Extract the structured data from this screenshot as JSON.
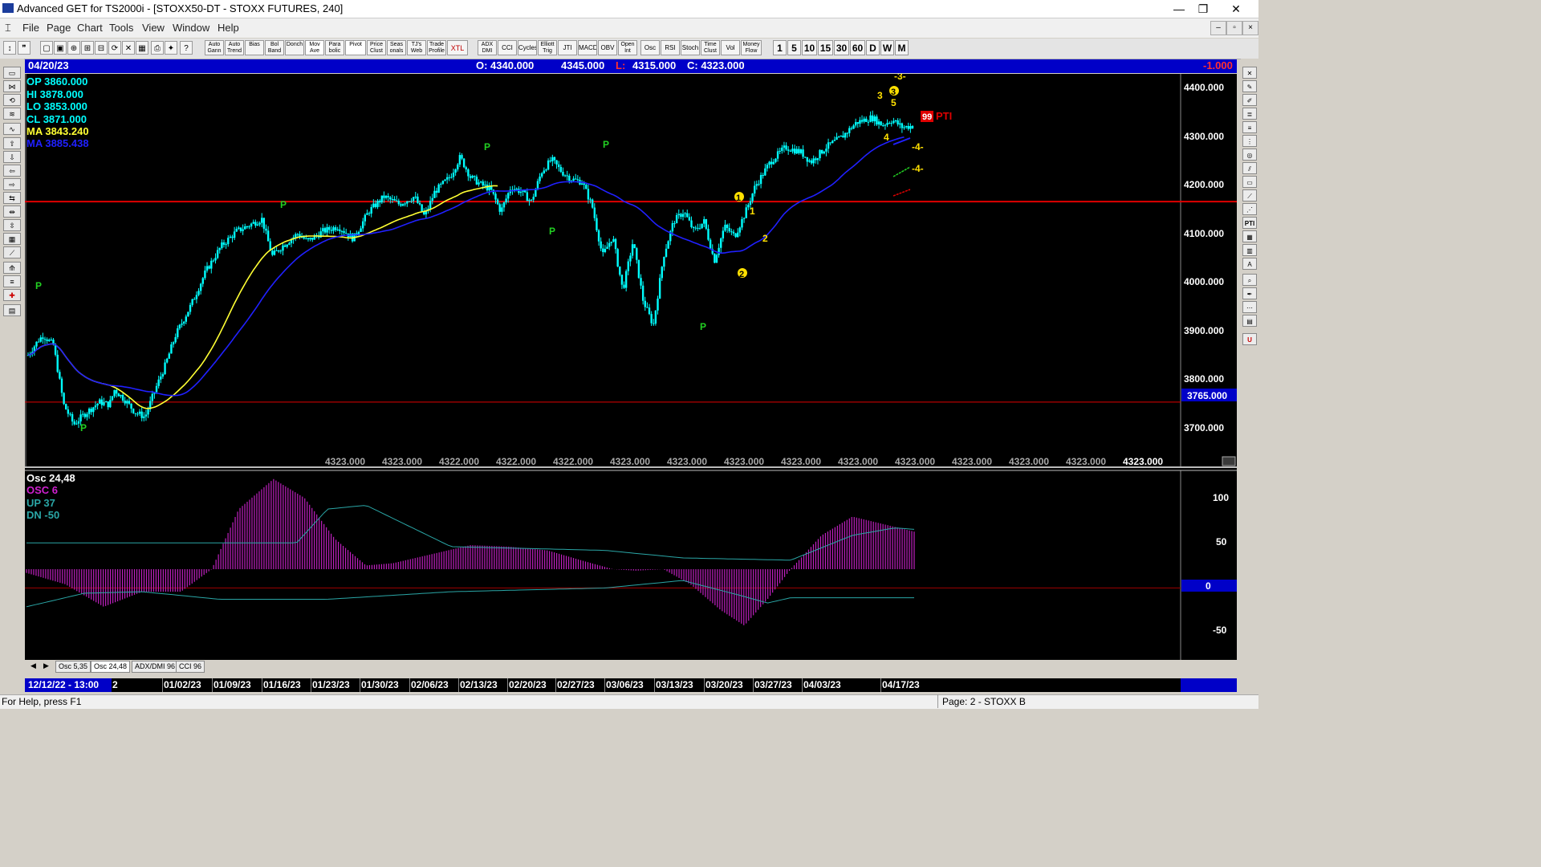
{
  "window": {
    "title": "Advanced GET for TS2000i - [STOXX50-DT - STOXX FUTURES, 240]",
    "buttons": [
      "—",
      "❐",
      "✕"
    ]
  },
  "menu": {
    "items": [
      "File",
      "Page",
      "Chart",
      "Tools",
      "View",
      "Window",
      "Help"
    ]
  },
  "toolbar": {
    "study_buttons": [
      "Auto Gann",
      "Auto Trend",
      "Bias",
      "Bol Band",
      "Donch",
      "Mov Ave",
      "Para bolic",
      "Pivot",
      "Price Clust",
      "Seas onals",
      "TJ's Web",
      "Trade Profile",
      "XTL",
      "ADX DMI",
      "CCI",
      "Cycles",
      "Elliott Trig",
      "JTI",
      "MACD",
      "OBV",
      "Open Int",
      "Osc",
      "RSI",
      "Stoch",
      "Time Clust",
      "Vol",
      "Money Flow"
    ],
    "timeframes": [
      "1",
      "5",
      "10",
      "15",
      "30",
      "60",
      "D",
      "W",
      "M"
    ]
  },
  "infobar": {
    "date": "04/20/23",
    "open": "O: 4340.000",
    "high": "4345.000",
    "low_label": "L:",
    "low": "4315.000",
    "close": "C: 4323.000",
    "change": "-1.000"
  },
  "legend": {
    "op": "OP  3860.000",
    "hi": "HI   3878.000",
    "lo": "LO   3853.000",
    "cl": "CL   3871.000",
    "ma": "MA  3843.240",
    "ma2": "MA  3885.438"
  },
  "chart_data": [
    {
      "type": "candlestick",
      "title": "STOXX50-DT - STOXX FUTURES, 240",
      "ylim": [
        3640,
        4420
      ],
      "y_ticks": [
        "4400.000",
        "4300.000",
        "4200.000",
        "4100.000",
        "4000.000",
        "3900.000",
        "3800.000",
        "3700.000"
      ],
      "price_path": [
        [
          0,
          3860
        ],
        [
          2,
          3890
        ],
        [
          3,
          3900
        ],
        [
          5,
          3880
        ],
        [
          7,
          3760
        ],
        [
          9,
          3720
        ],
        [
          11,
          3740
        ],
        [
          14,
          3765
        ],
        [
          16,
          3760
        ],
        [
          17,
          3790
        ],
        [
          19,
          3770
        ],
        [
          21,
          3745
        ],
        [
          23,
          3735
        ],
        [
          25,
          3790
        ],
        [
          27,
          3840
        ],
        [
          29,
          3900
        ],
        [
          32,
          3960
        ],
        [
          35,
          4030
        ],
        [
          38,
          4080
        ],
        [
          41,
          4110
        ],
        [
          44,
          4125
        ],
        [
          46,
          4135
        ],
        [
          48,
          4060
        ],
        [
          50,
          4080
        ],
        [
          53,
          4105
        ],
        [
          55,
          4090
        ],
        [
          58,
          4110
        ],
        [
          61,
          4120
        ],
        [
          64,
          4095
        ],
        [
          67,
          4150
        ],
        [
          70,
          4180
        ],
        [
          73,
          4165
        ],
        [
          76,
          4180
        ],
        [
          78,
          4140
        ],
        [
          80,
          4190
        ],
        [
          83,
          4220
        ],
        [
          85,
          4260
        ],
        [
          87,
          4220
        ],
        [
          89,
          4205
        ],
        [
          91,
          4195
        ],
        [
          93,
          4150
        ],
        [
          95,
          4200
        ],
        [
          97,
          4190
        ],
        [
          99,
          4170
        ],
        [
          101,
          4230
        ],
        [
          103,
          4255
        ],
        [
          105,
          4230
        ],
        [
          107,
          4215
        ],
        [
          109,
          4210
        ],
        [
          111,
          4160
        ],
        [
          113,
          4060
        ],
        [
          115,
          4100
        ],
        [
          117,
          3990
        ],
        [
          119,
          4090
        ],
        [
          121,
          3970
        ],
        [
          123,
          3920
        ],
        [
          125,
          4060
        ],
        [
          127,
          4130
        ],
        [
          129,
          4150
        ],
        [
          131,
          4110
        ],
        [
          133,
          4130
        ],
        [
          135,
          4050
        ],
        [
          137,
          4120
        ],
        [
          139,
          4100
        ],
        [
          141,
          4145
        ],
        [
          143,
          4200
        ],
        [
          146,
          4250
        ],
        [
          149,
          4280
        ],
        [
          152,
          4270
        ],
        [
          154,
          4250
        ],
        [
          157,
          4280
        ],
        [
          160,
          4300
        ],
        [
          163,
          4330
        ],
        [
          166,
          4340
        ],
        [
          168,
          4325
        ],
        [
          170,
          4335
        ],
        [
          172,
          4320
        ],
        [
          174,
          4323
        ]
      ],
      "pivot_labels": [
        "P",
        "P",
        "P",
        "P",
        "P",
        "P",
        "P",
        "P"
      ],
      "wave_labels": [
        "1",
        "2",
        "1",
        "2",
        "3",
        "4",
        "5",
        "3",
        "-3-",
        "-4-",
        "-4-"
      ],
      "pti_value": "99",
      "pti_label": "PTI",
      "hlines": [
        {
          "value": 4170,
          "color": "#e00000"
        },
        {
          "value": 3765,
          "color": "#e00000",
          "label": "3765.000"
        }
      ],
      "bottom_values": [
        "4323.000",
        "4323.000",
        "4322.000",
        "4322.000",
        "4322.000",
        "4323.000",
        "4323.000",
        "4323.000",
        "4323.000",
        "4323.000",
        "4323.000",
        "4323.000",
        "4323.000",
        "4323.000",
        "4323.000"
      ]
    },
    {
      "type": "bar",
      "title": "Osc 24,48",
      "series": [
        {
          "name": "OSC 6"
        },
        {
          "name": "UP 37"
        },
        {
          "name": "DN -50"
        }
      ],
      "ylim": [
        -110,
        125
      ],
      "y_ticks": [
        "100",
        "50",
        "0",
        "-50"
      ],
      "osc_path": [
        [
          0,
          -5
        ],
        [
          10,
          -20
        ],
        [
          20,
          -50
        ],
        [
          30,
          -30
        ],
        [
          40,
          -30
        ],
        [
          48,
          0
        ],
        [
          55,
          80
        ],
        [
          64,
          120
        ],
        [
          72,
          95
        ],
        [
          80,
          40
        ],
        [
          88,
          5
        ],
        [
          95,
          8
        ],
        [
          105,
          20
        ],
        [
          115,
          32
        ],
        [
          125,
          30
        ],
        [
          135,
          25
        ],
        [
          145,
          10
        ],
        [
          152,
          0
        ],
        [
          158,
          -2
        ],
        [
          165,
          0
        ],
        [
          172,
          -20
        ],
        [
          180,
          -55
        ],
        [
          186,
          -75
        ],
        [
          192,
          -40
        ],
        [
          198,
          0
        ],
        [
          206,
          45
        ],
        [
          214,
          70
        ],
        [
          222,
          60
        ],
        [
          230,
          50
        ]
      ],
      "up_path": [
        [
          0,
          35
        ],
        [
          70,
          35
        ],
        [
          78,
          80
        ],
        [
          88,
          85
        ],
        [
          110,
          30
        ],
        [
          150,
          25
        ],
        [
          170,
          15
        ],
        [
          198,
          12
        ],
        [
          214,
          45
        ],
        [
          225,
          55
        ],
        [
          230,
          53
        ]
      ],
      "dn_path": [
        [
          0,
          -50
        ],
        [
          15,
          -32
        ],
        [
          30,
          -30
        ],
        [
          50,
          -40
        ],
        [
          78,
          -40
        ],
        [
          110,
          -30
        ],
        [
          150,
          -25
        ],
        [
          170,
          -15
        ],
        [
          185,
          -35
        ],
        [
          192,
          -45
        ],
        [
          198,
          -38
        ],
        [
          230,
          -38
        ]
      ]
    }
  ],
  "osc_legend": {
    "title": "Osc 24,48",
    "osc": "OSC 6",
    "up": "UP  37",
    "dn": "DN  -50"
  },
  "osc_zero_label": "0",
  "tabs": [
    "Osc 5,35",
    "Osc 24,48",
    "ADX/DMI 96",
    "CCI 96"
  ],
  "dates": {
    "current": "12/12/22 - 13:00",
    "fragment": "2",
    "labels": [
      "01/02/23",
      "01/09/23",
      "01/16/23",
      "01/23/23",
      "01/30/23",
      "02/06/23",
      "02/13/23",
      "02/20/23",
      "02/27/23",
      "03/06/23",
      "03/13/23",
      "03/20/23",
      "03/27/23",
      "04/03/23",
      "04/17/23"
    ]
  },
  "status": {
    "help": "For Help, press F1",
    "page": "Page: 2 - STOXX B"
  },
  "colors": {
    "candle": "#00ffff",
    "ma_yellow": "#ffff33",
    "ma_blue": "#2020ff",
    "osc_bar": "#c020c0",
    "band_line": "#2aa6a6",
    "pivot": "#22d022",
    "wave": "#ffe000",
    "info_bg": "#0000c8"
  }
}
